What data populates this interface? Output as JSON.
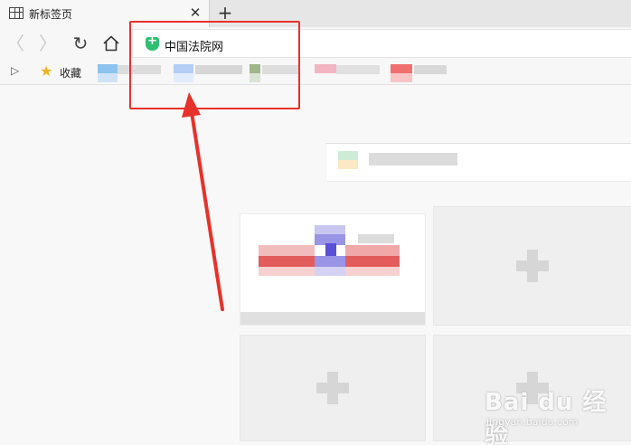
{
  "tab": {
    "title": "新标签页",
    "close_glyph": "✕",
    "icon": "new-tab-page-icon"
  },
  "new_tab_glyph": "+",
  "toolbar": {
    "back_glyph": "〈",
    "forward_glyph": "〉",
    "reload_glyph": "↻",
    "home_icon": "home-icon"
  },
  "address": {
    "url": "中国法院网",
    "security_icon": "green-shield-icon"
  },
  "bookmarks": {
    "toggle_glyph": "▷",
    "label": "收藏",
    "star_glyph": "★"
  },
  "watermark": {
    "main": "Bai du 经验",
    "sub": "jingyan.baidu.com"
  },
  "colors": {
    "annotation_red": "#e8312a",
    "shield_green": "#2fbf71",
    "star_yellow": "#f2b01e"
  }
}
